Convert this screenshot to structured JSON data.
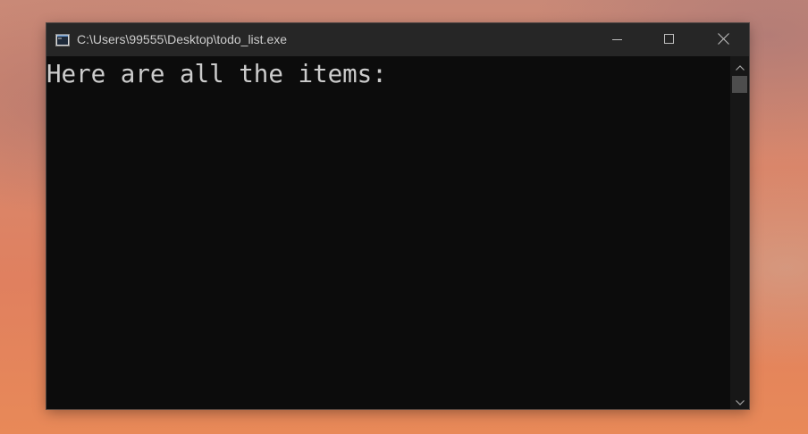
{
  "window": {
    "title": "C:\\Users\\99555\\Desktop\\todo_list.exe",
    "icon": "console-app-icon",
    "controls": {
      "minimize_icon": "minimize-icon",
      "maximize_icon": "maximize-icon",
      "close_icon": "close-icon"
    }
  },
  "console": {
    "lines": [
      "Here are all the items:"
    ],
    "background_color": "#0c0c0c",
    "text_color": "#cccccc"
  },
  "scrollbar": {
    "up_icon": "chevron-up-icon",
    "down_icon": "chevron-down-icon"
  }
}
